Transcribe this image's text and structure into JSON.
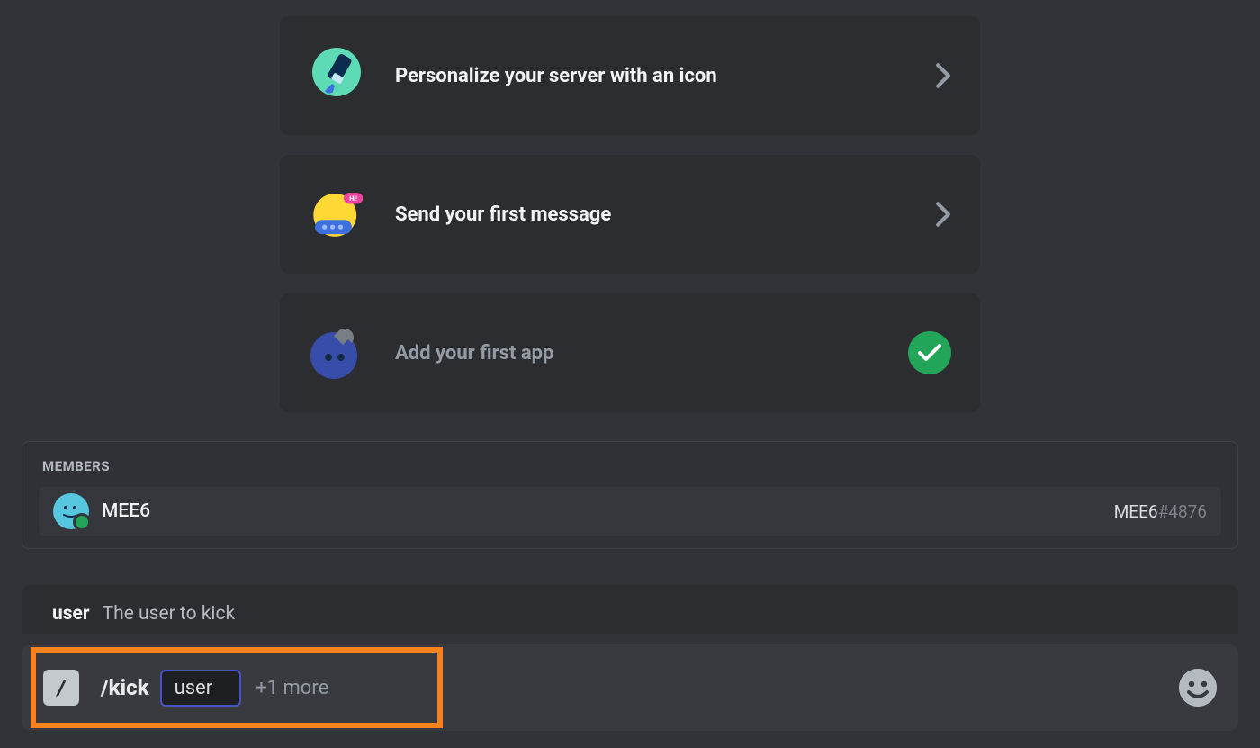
{
  "cards": {
    "personalize": {
      "title": "Personalize your server with an icon",
      "completed": false
    },
    "first_message": {
      "title": "Send your first message",
      "completed": false
    },
    "first_app": {
      "title": "Add your first app",
      "completed": true
    }
  },
  "suggest": {
    "header": "Members",
    "member": {
      "name": "MEE6",
      "tag_name": "MEE6",
      "discrim": "#4876"
    }
  },
  "param": {
    "name": "user",
    "desc": "The user to kick"
  },
  "input": {
    "command": "/kick",
    "arg_label": "user",
    "more": "+1 more",
    "slash_glyph": "/"
  }
}
